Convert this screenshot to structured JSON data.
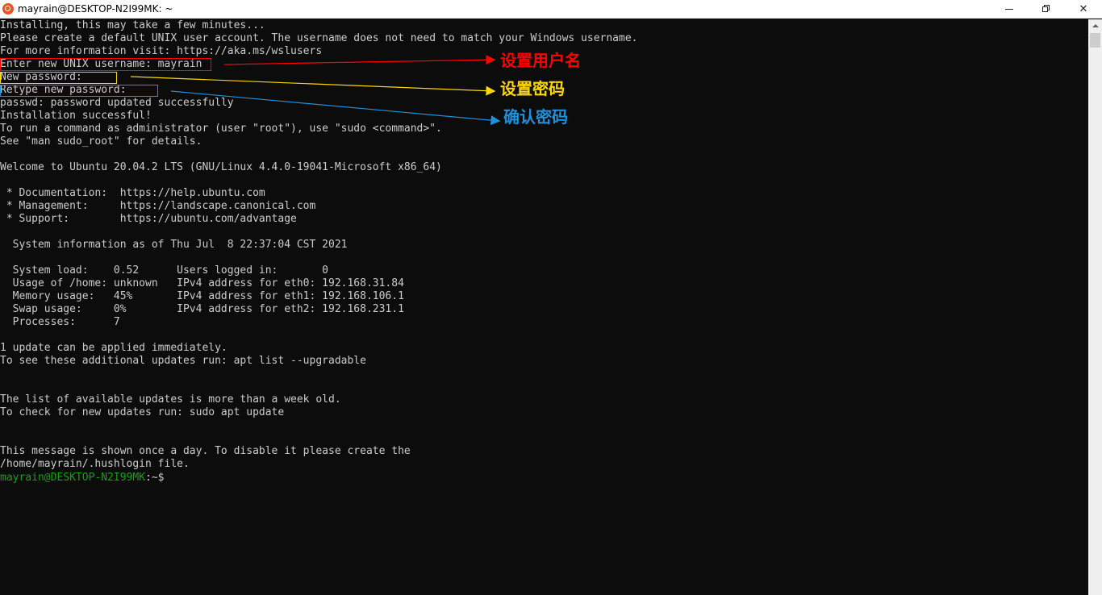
{
  "window": {
    "title": "mayrain@DESKTOP-N2I99MK: ~",
    "icon": "ubuntu-icon",
    "controls": [
      "minimize-icon",
      "maximize-icon",
      "close-icon"
    ]
  },
  "colors": {
    "terminal_bg": "#0c0c0c",
    "terminal_fg": "#cccccc",
    "prompt_green": "#13a10e",
    "annotation_red": "#ff0000",
    "annotation_yellow": "#ffd700",
    "annotation_blue": "#1e90dc"
  },
  "terminal": {
    "lines": [
      "Installing, this may take a few minutes...",
      "Please create a default UNIX user account. The username does not need to match your Windows username.",
      "For more information visit: https://aka.ms/wslusers",
      "Enter new UNIX username: mayrain",
      "New password:",
      "Retype new password:",
      "passwd: password updated successfully",
      "Installation successful!",
      "To run a command as administrator (user \"root\"), use \"sudo <command>\".",
      "See \"man sudo_root\" for details.",
      "",
      "Welcome to Ubuntu 20.04.2 LTS (GNU/Linux 4.4.0-19041-Microsoft x86_64)",
      "",
      " * Documentation:  https://help.ubuntu.com",
      " * Management:     https://landscape.canonical.com",
      " * Support:        https://ubuntu.com/advantage",
      "",
      "  System information as of Thu Jul  8 22:37:04 CST 2021",
      "",
      "  System load:    0.52      Users logged in:       0",
      "  Usage of /home: unknown   IPv4 address for eth0: 192.168.31.84",
      "  Memory usage:   45%       IPv4 address for eth1: 192.168.106.1",
      "  Swap usage:     0%        IPv4 address for eth2: 192.168.231.1",
      "  Processes:      7",
      "",
      "1 update can be applied immediately.",
      "To see these additional updates run: apt list --upgradable",
      "",
      "",
      "The list of available updates is more than a week old.",
      "To check for new updates run: sudo apt update",
      "",
      "",
      "This message is shown once a day. To disable it please create the",
      "/home/mayrain/.hushlogin file."
    ],
    "prompt": {
      "user_host": "mayrain@DESKTOP-N2I99MK",
      "path": ":~$"
    }
  },
  "annotations": {
    "username": "设置用户名",
    "password": "设置密码",
    "confirm": "确认密码"
  }
}
